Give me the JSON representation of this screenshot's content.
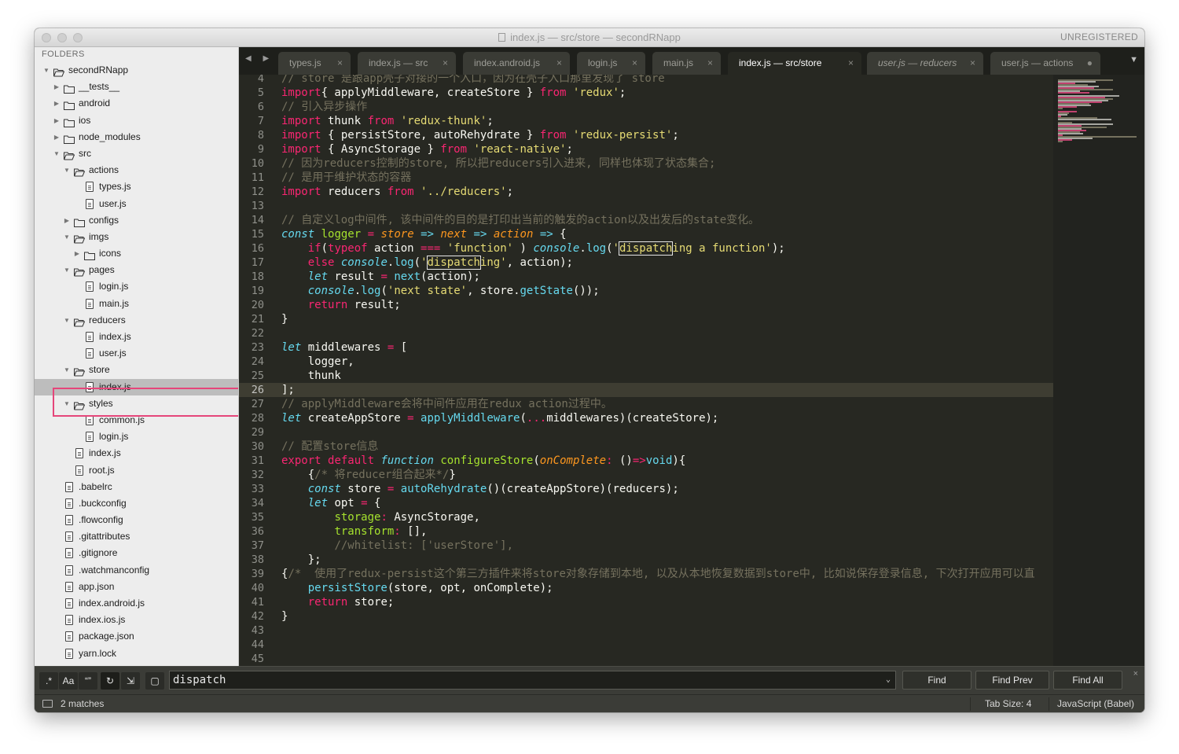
{
  "window": {
    "title": "index.js — src/store — secondRNapp",
    "license": "UNREGISTERED"
  },
  "sidebar": {
    "header": "FOLDERS",
    "tree": [
      {
        "label": "secondRNapp",
        "depth": 0,
        "type": "folder",
        "open": true
      },
      {
        "label": "__tests__",
        "depth": 1,
        "type": "folder",
        "open": false
      },
      {
        "label": "android",
        "depth": 1,
        "type": "folder",
        "open": false
      },
      {
        "label": "ios",
        "depth": 1,
        "type": "folder",
        "open": false
      },
      {
        "label": "node_modules",
        "depth": 1,
        "type": "folder",
        "open": false
      },
      {
        "label": "src",
        "depth": 1,
        "type": "folder",
        "open": true
      },
      {
        "label": "actions",
        "depth": 2,
        "type": "folder",
        "open": true
      },
      {
        "label": "types.js",
        "depth": 3,
        "type": "file"
      },
      {
        "label": "user.js",
        "depth": 3,
        "type": "file"
      },
      {
        "label": "configs",
        "depth": 2,
        "type": "folder",
        "open": false
      },
      {
        "label": "imgs",
        "depth": 2,
        "type": "folder",
        "open": true
      },
      {
        "label": "icons",
        "depth": 3,
        "type": "folder",
        "open": false
      },
      {
        "label": "pages",
        "depth": 2,
        "type": "folder",
        "open": true
      },
      {
        "label": "login.js",
        "depth": 3,
        "type": "file"
      },
      {
        "label": "main.js",
        "depth": 3,
        "type": "file"
      },
      {
        "label": "reducers",
        "depth": 2,
        "type": "folder",
        "open": true
      },
      {
        "label": "index.js",
        "depth": 3,
        "type": "file"
      },
      {
        "label": "user.js",
        "depth": 3,
        "type": "file"
      },
      {
        "label": "store",
        "depth": 2,
        "type": "folder",
        "open": true
      },
      {
        "label": "index.js",
        "depth": 3,
        "type": "file",
        "selected": true
      },
      {
        "label": "styles",
        "depth": 2,
        "type": "folder",
        "open": true
      },
      {
        "label": "common.js",
        "depth": 3,
        "type": "file"
      },
      {
        "label": "login.js",
        "depth": 3,
        "type": "file"
      },
      {
        "label": "index.js",
        "depth": 2,
        "type": "file"
      },
      {
        "label": "root.js",
        "depth": 2,
        "type": "file"
      },
      {
        "label": ".babelrc",
        "depth": 1,
        "type": "file"
      },
      {
        "label": ".buckconfig",
        "depth": 1,
        "type": "file"
      },
      {
        "label": ".flowconfig",
        "depth": 1,
        "type": "file"
      },
      {
        "label": ".gitattributes",
        "depth": 1,
        "type": "file"
      },
      {
        "label": ".gitignore",
        "depth": 1,
        "type": "file"
      },
      {
        "label": ".watchmanconfig",
        "depth": 1,
        "type": "file"
      },
      {
        "label": "app.json",
        "depth": 1,
        "type": "file"
      },
      {
        "label": "index.android.js",
        "depth": 1,
        "type": "file"
      },
      {
        "label": "index.ios.js",
        "depth": 1,
        "type": "file"
      },
      {
        "label": "package.json",
        "depth": 1,
        "type": "file"
      },
      {
        "label": "yarn.lock",
        "depth": 1,
        "type": "file"
      }
    ]
  },
  "tabs": [
    {
      "label": "types.js",
      "close": "×"
    },
    {
      "label": "index.js — src",
      "close": "×"
    },
    {
      "label": "index.android.js",
      "close": "×"
    },
    {
      "label": "login.js",
      "close": "×"
    },
    {
      "label": "main.js",
      "close": "×"
    },
    {
      "label": "index.js — src/store",
      "close": "×",
      "active": true
    },
    {
      "label": "user.js — reducers",
      "close": "×",
      "italic": true
    },
    {
      "label": "user.js — actions",
      "close": "●"
    }
  ],
  "tab_nav": {
    "arrows": "◀ ▶",
    "overflow": "▼"
  },
  "editor": {
    "lines": [
      {
        "n": "4",
        "tokens": [
          [
            "c",
            "// store 是跟app壳子对接的一个入口，因为在壳子入口那里发现了 store"
          ]
        ]
      },
      {
        "n": "5",
        "tokens": [
          [
            "k",
            "import"
          ],
          [
            "",
            "{ applyMiddleware, createStore } "
          ],
          [
            "k",
            "from"
          ],
          [
            "",
            " "
          ],
          [
            "s",
            "'redux'"
          ],
          [
            "",
            ";"
          ]
        ]
      },
      {
        "n": "6",
        "tokens": [
          [
            "c",
            "// 引入异步操作"
          ]
        ]
      },
      {
        "n": "7",
        "tokens": [
          [
            "k",
            "import"
          ],
          [
            "",
            " thunk "
          ],
          [
            "k",
            "from"
          ],
          [
            "",
            " "
          ],
          [
            "s",
            "'redux-thunk'"
          ],
          [
            "",
            ";"
          ]
        ]
      },
      {
        "n": "8",
        "tokens": [
          [
            "k",
            "import"
          ],
          [
            "",
            " { persistStore, autoRehydrate } "
          ],
          [
            "k",
            "from"
          ],
          [
            "",
            " "
          ],
          [
            "s",
            "'redux-persist'"
          ],
          [
            "",
            ";"
          ]
        ]
      },
      {
        "n": "9",
        "tokens": [
          [
            "k",
            "import"
          ],
          [
            "",
            " { AsyncStorage } "
          ],
          [
            "k",
            "from"
          ],
          [
            "",
            " "
          ],
          [
            "s",
            "'react-native'"
          ],
          [
            "",
            ";"
          ]
        ]
      },
      {
        "n": "10",
        "tokens": [
          [
            "c",
            "// 因为reducers控制的store, 所以把reducers引入进来, 同样也体现了状态集合;"
          ]
        ]
      },
      {
        "n": "11",
        "tokens": [
          [
            "c",
            "// 是用于维护状态的容器"
          ]
        ]
      },
      {
        "n": "12",
        "tokens": [
          [
            "k",
            "import"
          ],
          [
            "",
            " reducers "
          ],
          [
            "k",
            "from"
          ],
          [
            "",
            " "
          ],
          [
            "s",
            "'../reducers'"
          ],
          [
            "",
            ";"
          ]
        ]
      },
      {
        "n": "13",
        "tokens": []
      },
      {
        "n": "14",
        "tokens": [
          [
            "c",
            "// 自定义log中间件, 该中间件的目的是打印出当前的触发的action以及出发后的state变化。"
          ]
        ]
      },
      {
        "n": "15",
        "tokens": [
          [
            "st",
            "const"
          ],
          [
            "",
            " "
          ],
          [
            "f",
            "logger"
          ],
          [
            "",
            " "
          ],
          [
            "op",
            "="
          ],
          [
            "",
            " "
          ],
          [
            "p",
            "store"
          ],
          [
            "",
            " "
          ],
          [
            "st",
            "=>"
          ],
          [
            "",
            " "
          ],
          [
            "p",
            "next"
          ],
          [
            "",
            " "
          ],
          [
            "st",
            "=>"
          ],
          [
            "",
            " "
          ],
          [
            "p",
            "action"
          ],
          [
            "",
            " "
          ],
          [
            "st",
            "=>"
          ],
          [
            "",
            " {"
          ]
        ]
      },
      {
        "n": "16",
        "tokens": [
          [
            "",
            "    "
          ],
          [
            "k",
            "if"
          ],
          [
            "",
            "("
          ],
          [
            "k",
            "typeof"
          ],
          [
            "",
            " action "
          ],
          [
            "op",
            "==="
          ],
          [
            "",
            " "
          ],
          [
            "s",
            "'function'"
          ],
          [
            "",
            " ) "
          ],
          [
            "st",
            "console"
          ],
          [
            "",
            "."
          ],
          [
            "fn",
            "log"
          ],
          [
            "",
            "("
          ],
          [
            "s",
            "'"
          ],
          [
            "m:match",
            "dispatch"
          ],
          [
            "s",
            "ing a function'"
          ],
          [
            "",
            ");"
          ]
        ]
      },
      {
        "n": "17",
        "tokens": [
          [
            "",
            "    "
          ],
          [
            "k",
            "else"
          ],
          [
            "",
            " "
          ],
          [
            "st",
            "console"
          ],
          [
            "",
            "."
          ],
          [
            "fn",
            "log"
          ],
          [
            "",
            "("
          ],
          [
            "s",
            "'"
          ],
          [
            "m:match",
            "dispatch"
          ],
          [
            "s",
            "ing'"
          ],
          [
            "",
            ", action);"
          ]
        ]
      },
      {
        "n": "18",
        "tokens": [
          [
            "",
            "    "
          ],
          [
            "st",
            "let"
          ],
          [
            "",
            " result "
          ],
          [
            "op",
            "="
          ],
          [
            "",
            " "
          ],
          [
            "fn",
            "next"
          ],
          [
            "",
            "(action);"
          ]
        ]
      },
      {
        "n": "19",
        "tokens": [
          [
            "",
            "    "
          ],
          [
            "st",
            "console"
          ],
          [
            "",
            "."
          ],
          [
            "fn",
            "log"
          ],
          [
            "",
            "("
          ],
          [
            "s",
            "'next state'"
          ],
          [
            "",
            ", store."
          ],
          [
            "fn",
            "getState"
          ],
          [
            "",
            "());"
          ]
        ]
      },
      {
        "n": "20",
        "tokens": [
          [
            "",
            "    "
          ],
          [
            "k",
            "return"
          ],
          [
            "",
            " result;"
          ]
        ]
      },
      {
        "n": "21",
        "tokens": [
          [
            "",
            "}"
          ]
        ]
      },
      {
        "n": "22",
        "tokens": []
      },
      {
        "n": "23",
        "tokens": [
          [
            "st",
            "let"
          ],
          [
            "",
            " middlewares "
          ],
          [
            "op",
            "="
          ],
          [
            "",
            " ["
          ]
        ]
      },
      {
        "n": "24",
        "tokens": [
          [
            "",
            "    logger,"
          ]
        ]
      },
      {
        "n": "25",
        "tokens": [
          [
            "",
            "    thunk"
          ]
        ]
      },
      {
        "n": "26",
        "tokens": [
          [
            "",
            "];"
          ]
        ]
      },
      {
        "n": "27",
        "tokens": [
          [
            "c",
            "// applyMiddleware会将中间件应用在redux action过程中。"
          ]
        ]
      },
      {
        "n": "28",
        "tokens": [
          [
            "st",
            "let"
          ],
          [
            "",
            " createAppStore "
          ],
          [
            "op",
            "="
          ],
          [
            "",
            " "
          ],
          [
            "fn",
            "applyMiddleware"
          ],
          [
            "",
            "("
          ],
          [
            "op",
            "..."
          ],
          [
            "",
            "middlewares)(createStore);"
          ]
        ]
      },
      {
        "n": "29",
        "tokens": []
      },
      {
        "n": "30",
        "tokens": [
          [
            "c",
            "// 配置store信息"
          ]
        ]
      },
      {
        "n": "31",
        "tokens": [
          [
            "k",
            "export"
          ],
          [
            "",
            " "
          ],
          [
            "k",
            "default"
          ],
          [
            "",
            " "
          ],
          [
            "st",
            "function"
          ],
          [
            "",
            " "
          ],
          [
            "cl",
            "configureStore"
          ],
          [
            "",
            "("
          ],
          [
            "p",
            "onComplete"
          ],
          [
            "op",
            ":"
          ],
          [
            "",
            " ()"
          ],
          [
            "op",
            "=>"
          ],
          [
            "fn",
            "void"
          ],
          [
            "",
            "){"
          ]
        ]
      },
      {
        "n": "32",
        "tokens": [
          [
            "",
            "    {"
          ],
          [
            "c",
            "/* 将reducer组合起来*/"
          ],
          [
            "",
            "}"
          ]
        ]
      },
      {
        "n": "33",
        "tokens": [
          [
            "",
            "    "
          ],
          [
            "st",
            "const"
          ],
          [
            "",
            " store "
          ],
          [
            "op",
            "="
          ],
          [
            "",
            " "
          ],
          [
            "fn",
            "autoRehydrate"
          ],
          [
            "",
            "()(createAppStore)(reducers);"
          ]
        ]
      },
      {
        "n": "34",
        "tokens": [
          [
            "",
            "    "
          ],
          [
            "st",
            "let"
          ],
          [
            "",
            " opt "
          ],
          [
            "op",
            "="
          ],
          [
            "",
            " {"
          ]
        ]
      },
      {
        "n": "35",
        "tokens": [
          [
            "",
            "        "
          ],
          [
            "cl",
            "storage"
          ],
          [
            "op",
            ":"
          ],
          [
            "",
            " AsyncStorage,"
          ]
        ]
      },
      {
        "n": "36",
        "tokens": [
          [
            "",
            "        "
          ],
          [
            "cl",
            "transform"
          ],
          [
            "op",
            ":"
          ],
          [
            "",
            " [],"
          ]
        ]
      },
      {
        "n": "37",
        "tokens": [
          [
            "",
            "        "
          ],
          [
            "c",
            "//whitelist: ['userStore'],"
          ]
        ]
      },
      {
        "n": "38",
        "tokens": [
          [
            "",
            "    };"
          ]
        ]
      },
      {
        "n": "39",
        "tokens": [
          [
            "",
            "{"
          ],
          [
            "c",
            "/*  使用了redux-persist这个第三方插件来将store对象存储到本地, 以及从本地恢复数据到store中, 比如说保存登录信息, 下次打开应用可以直"
          ]
        ]
      },
      {
        "n": "40",
        "tokens": [
          [
            "",
            "    "
          ],
          [
            "fn",
            "persistStore"
          ],
          [
            "",
            "(store, opt, onComplete);"
          ]
        ]
      },
      {
        "n": "41",
        "tokens": [
          [
            "",
            "    "
          ],
          [
            "k",
            "return"
          ],
          [
            "",
            " store;"
          ]
        ]
      },
      {
        "n": "42",
        "tokens": [
          [
            "",
            "}"
          ]
        ]
      },
      {
        "n": "43",
        "tokens": []
      },
      {
        "n": "44",
        "tokens": []
      },
      {
        "n": "45",
        "tokens": []
      }
    ]
  },
  "findbar": {
    "regex_label": ".*",
    "case_label": "Aa",
    "word_label": "“”",
    "wrap_label": "↻",
    "selection_label": "⇲",
    "highlight_label": "▢",
    "query": "dispatch",
    "dropdown": "⌄",
    "find": "Find",
    "find_prev": "Find Prev",
    "find_all": "Find All",
    "close": "×"
  },
  "statusbar": {
    "matches": "2 matches",
    "tab_size": "Tab Size: 4",
    "syntax": "JavaScript (Babel)"
  }
}
